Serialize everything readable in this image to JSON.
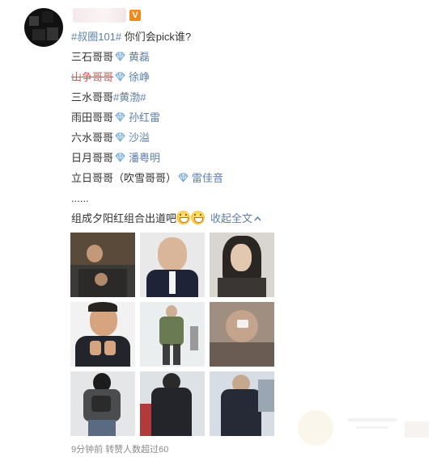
{
  "post": {
    "topic": "#叔圈101#",
    "question": " 你们会pick谁?",
    "lines": [
      {
        "nick": "三石哥哥",
        "name": "黄磊"
      },
      {
        "nick": "山争哥哥",
        "name": "徐峥"
      },
      {
        "nick": "三水哥哥",
        "name": "#黄渤#"
      },
      {
        "nick": "雨田哥哥",
        "name": "孙红雷"
      },
      {
        "nick": "六水哥哥",
        "name": "沙溢"
      },
      {
        "nick": "日月哥哥",
        "name": "潘粤明"
      },
      {
        "nick": "立日哥哥（吹雪哥哥）",
        "name": "雷佳音"
      }
    ],
    "ellipsis": "......",
    "closing": "组成夕阳红组合出道吧",
    "collapse_label": "收起全文"
  },
  "footer": {
    "time": "9分钟前",
    "reposts": "转赞人数超过60"
  },
  "badge": "V",
  "colors": {
    "link": "#5d7fa8",
    "highlight": "#d15a5a",
    "footer_text": "#8a8a8a"
  }
}
